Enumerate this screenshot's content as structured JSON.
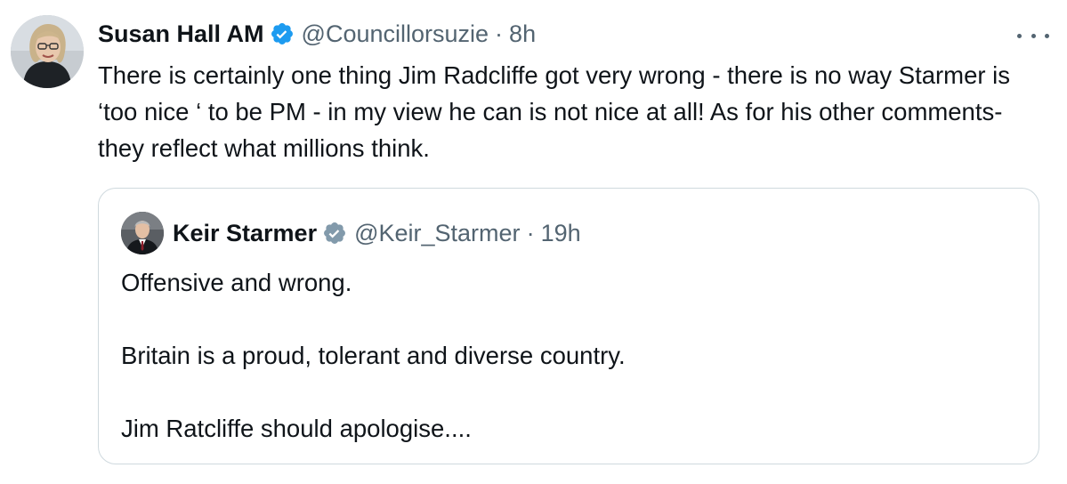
{
  "tweet": {
    "author": {
      "display_name": "Susan Hall AM",
      "handle": "@Councillorsuzie",
      "time": "8h",
      "verified_icon": "verified-badge-icon"
    },
    "separator": "·",
    "text": "There is certainly one thing Jim Radcliffe got very wrong - there is no way Starmer is ‘too nice ‘ to be PM - in my view he can is not nice at all! As for his other comments- they reflect what millions think.",
    "more_icon": "more-options-icon"
  },
  "quote": {
    "author": {
      "display_name": "Keir Starmer",
      "handle": "@Keir_Starmer",
      "time": "19h",
      "verified_icon": "gray-verified-badge-icon"
    },
    "separator": "·",
    "paragraphs": [
      "Offensive and wrong.",
      "Britain is a proud, tolerant and diverse country.",
      "Jim Ratcliffe should apologise...."
    ]
  },
  "colors": {
    "verified_blue": "#1d9bf0",
    "verified_gray": "#829aab",
    "secondary_text": "#536471",
    "border": "#cfd9de"
  }
}
